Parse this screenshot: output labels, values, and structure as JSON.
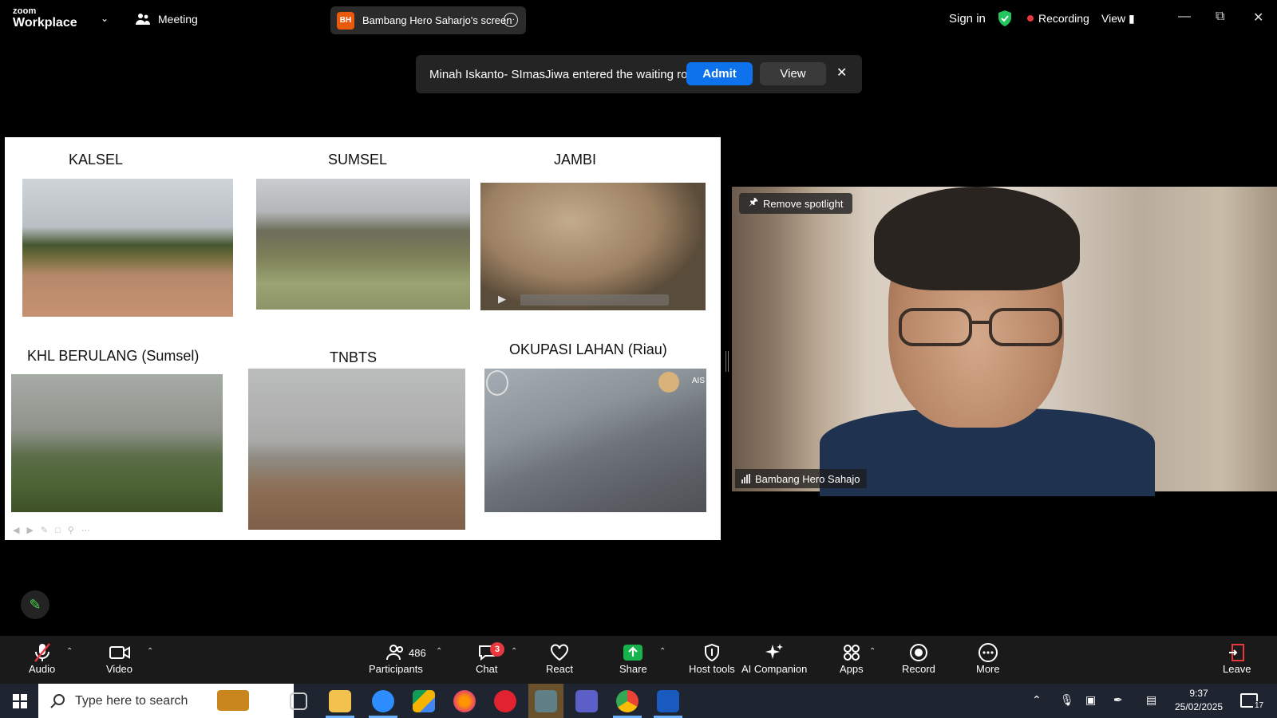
{
  "titlebar": {
    "logo_top": "zoom",
    "logo_bottom": "Workplace",
    "meeting_label": "Meeting",
    "share_initials": "BH",
    "share_title": "Bambang Hero Saharjo's screen",
    "signin": "Sign in",
    "recording": "Recording",
    "view": "View"
  },
  "notification": {
    "message": "Minah Iskanto- SImasJiwa entered the waiting room",
    "admit": "Admit",
    "view": "View"
  },
  "slide": {
    "labels": [
      "KALSEL",
      "SUMSEL",
      "JAMBI",
      "KHL BERULANG (Sumsel)",
      "TNBTS",
      "OKUPASI LAHAN (Riau)"
    ],
    "okupasi_watermark": "AIS"
  },
  "video": {
    "remove_spotlight": "Remove spotlight",
    "participant_name": "Bambang Hero Sahajo"
  },
  "toolbar": {
    "audio": "Audio",
    "video": "Video",
    "participants": "Participants",
    "participants_count": "486",
    "chat": "Chat",
    "chat_badge": "3",
    "react": "React",
    "share": "Share",
    "host_tools": "Host tools",
    "ai_companion": "AI Companion",
    "apps": "Apps",
    "record": "Record",
    "more": "More",
    "leave": "Leave"
  },
  "taskbar": {
    "search_placeholder": "Type here to search",
    "time": "9:37",
    "date": "25/02/2025",
    "notification_count": "17"
  },
  "colors": {
    "accent": "#0e72ed",
    "recording": "#e8373f",
    "share_green": "#16b24b",
    "shield_green": "#22c55e"
  }
}
